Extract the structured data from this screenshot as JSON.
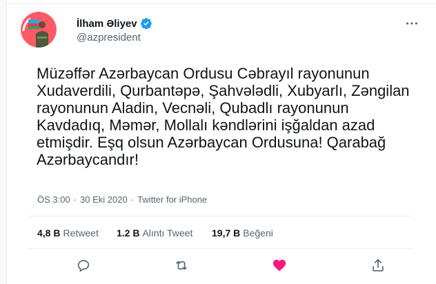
{
  "author": {
    "name": "İlham Əliyev",
    "handle": "@azpresident",
    "verified": true
  },
  "tweet": {
    "lines": [
      "Müzəffər Azərbaycan Ordusu Cəbrayıl rayonunun",
      "Xudaverdili, Qurbantəpə, Şahvələdli, Xubyarlı, Zəngilan",
      "rayonunun Aladin, Vecnəli, Qubadlı rayonunun",
      "Kavdadıq, Məmər, Mollalı kəndlərini işğaldan azad",
      "etmişdir. Eşq olsun Azərbaycan Ordusuna! Qarabağ",
      "Azərbaycandır!"
    ]
  },
  "meta": {
    "time": "ÖS 3:00",
    "date": "30 Eki 2020",
    "separator": "·",
    "source": "Twitter for iPhone"
  },
  "stats": {
    "retweets": {
      "value": "4,8 B",
      "label": "Retweet"
    },
    "quotes": {
      "value": "1.2 B",
      "label": "Alıntı Tweet"
    },
    "likes": {
      "value": "19,7 B",
      "label": "Beğeni"
    }
  },
  "icons": {
    "more": "more-dots-icon",
    "reply": "reply-icon",
    "retweet": "retweet-icon",
    "like": "heart-icon",
    "share": "share-icon",
    "verified": "verified-badge-icon"
  },
  "colors": {
    "verified": "#1d9bf0",
    "like": "#f91880",
    "secondary_text": "#536471",
    "primary_text": "#0f1419",
    "avatar_bg": "#ff5a66"
  }
}
